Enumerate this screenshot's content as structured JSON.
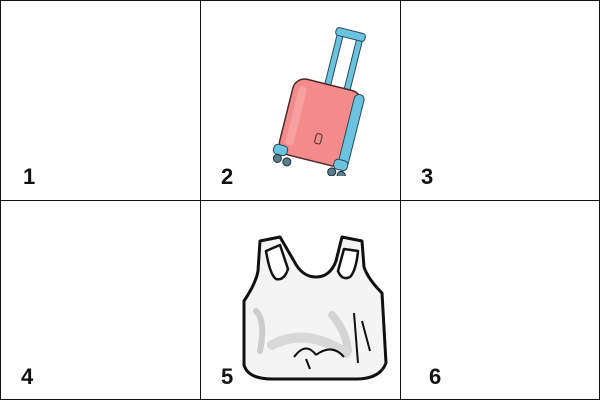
{
  "cells": [
    {
      "label": "1",
      "image": ""
    },
    {
      "label": "2",
      "image": "suitcase"
    },
    {
      "label": "3",
      "image": ""
    },
    {
      "label": "4",
      "image": ""
    },
    {
      "label": "5",
      "image": "plastic-bag"
    },
    {
      "label": "6",
      "image": ""
    }
  ],
  "colors": {
    "grid_line": "#111111",
    "suitcase_body": "#f48b8b",
    "suitcase_trim": "#6cc3e0",
    "bag_fill": "#f4f4f4"
  }
}
